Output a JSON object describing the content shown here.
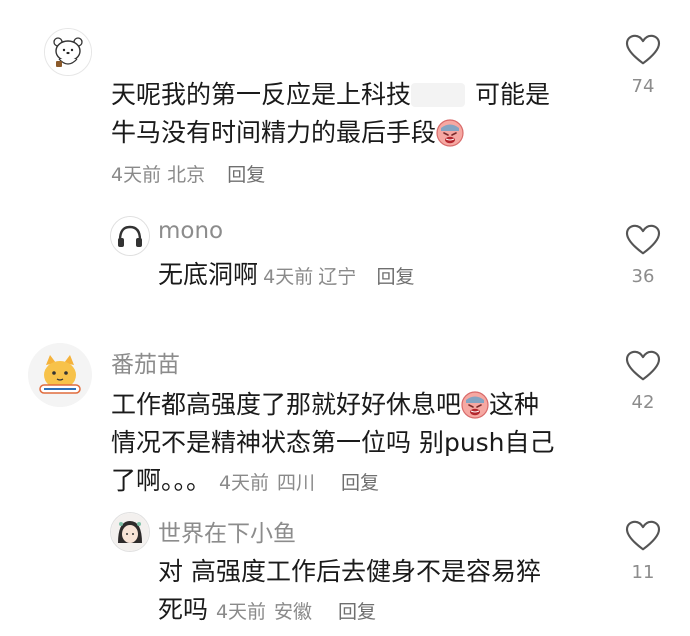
{
  "comments": [
    {
      "avatar_icon": "bear-avatar-icon",
      "text_before": "天呢我的第一反应是上科技",
      "text_after": "可能是",
      "text_line2": "牛马没有时间精力的最后手段",
      "time": "4天前",
      "location": "北京",
      "reply_label": "回复",
      "like_count": "74",
      "reply": {
        "username": "mono",
        "avatar_icon": "headphones-avatar-icon",
        "text": "无底洞啊",
        "time": "4天前",
        "location": "辽宁",
        "reply_label": "回复",
        "like_count": "36"
      }
    },
    {
      "username": "番茄苗",
      "avatar_icon": "cat-avatar-icon",
      "text_line1a": "工作都高强度了那就好好休息吧",
      "text_line1b": "这种",
      "text_line2": "情况不是精神状态第一位吗 别push自己",
      "text_line3": "了啊。。。",
      "time": "4天前",
      "location": "四川",
      "reply_label": "回复",
      "like_count": "42",
      "reply": {
        "username": "世界在下小鱼",
        "avatar_icon": "girl-avatar-icon",
        "text_line1": "对 高强度工作后去健身不是容易猝",
        "text_line2": "死吗",
        "time": "4天前",
        "location": "安徽",
        "reply_label": "回复",
        "like_count": "11"
      }
    }
  ],
  "emoji_name": "crying-face-emoji",
  "colors": {
    "text": "#1a1a1a",
    "meta": "#8a8a8a",
    "heart_outline": "#555555"
  }
}
